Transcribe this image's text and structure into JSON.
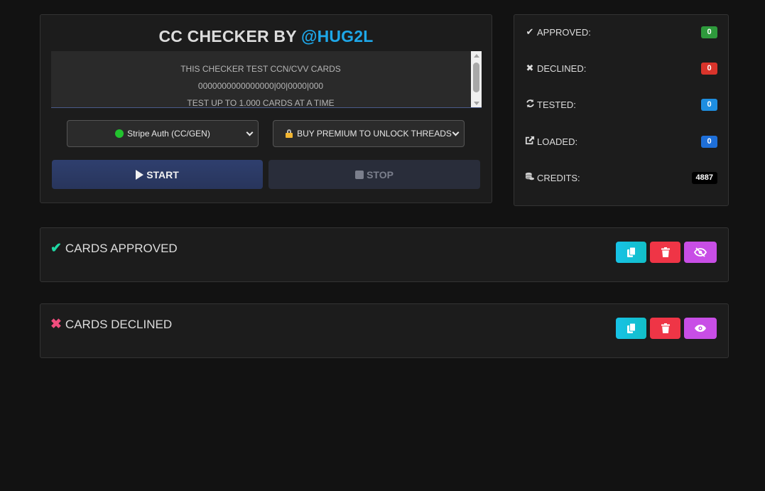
{
  "checker": {
    "title_prefix": "CC CHECKER BY ",
    "title_handle": "@HUG2L",
    "info_lines": [
      "THIS CHECKER TEST CCN/CVV CARDS",
      "0000000000000000|00|0000|000",
      "TEST UP TO 1.000 CARDS AT A TIME"
    ],
    "gate_select": "Stripe Auth (CC/GEN)",
    "threads_select": "BUY PREMIUM TO UNLOCK THREADS",
    "start_label": "START",
    "stop_label": "STOP"
  },
  "stats": {
    "approved": {
      "label": "APPROVED:",
      "value": "0",
      "color": "#2e9a3c",
      "icon": "check-icon"
    },
    "declined": {
      "label": "DECLINED:",
      "value": "0",
      "color": "#d9342b",
      "icon": "times-icon"
    },
    "tested": {
      "label": "TESTED:",
      "value": "0",
      "color": "#1e8ee0",
      "icon": "sync-icon"
    },
    "loaded": {
      "label": "LOADED:",
      "value": "0",
      "color": "#1e6fd9",
      "icon": "share-icon"
    },
    "credits": {
      "label": "CREDITS:",
      "value": "4887",
      "color": "#000000",
      "icon": "coins-icon"
    }
  },
  "results": {
    "approved_title": "CARDS APPROVED",
    "declined_title": "CARDS DECLINED",
    "approved_accent": "#1fd6a3",
    "declined_accent": "#f04d7d"
  }
}
